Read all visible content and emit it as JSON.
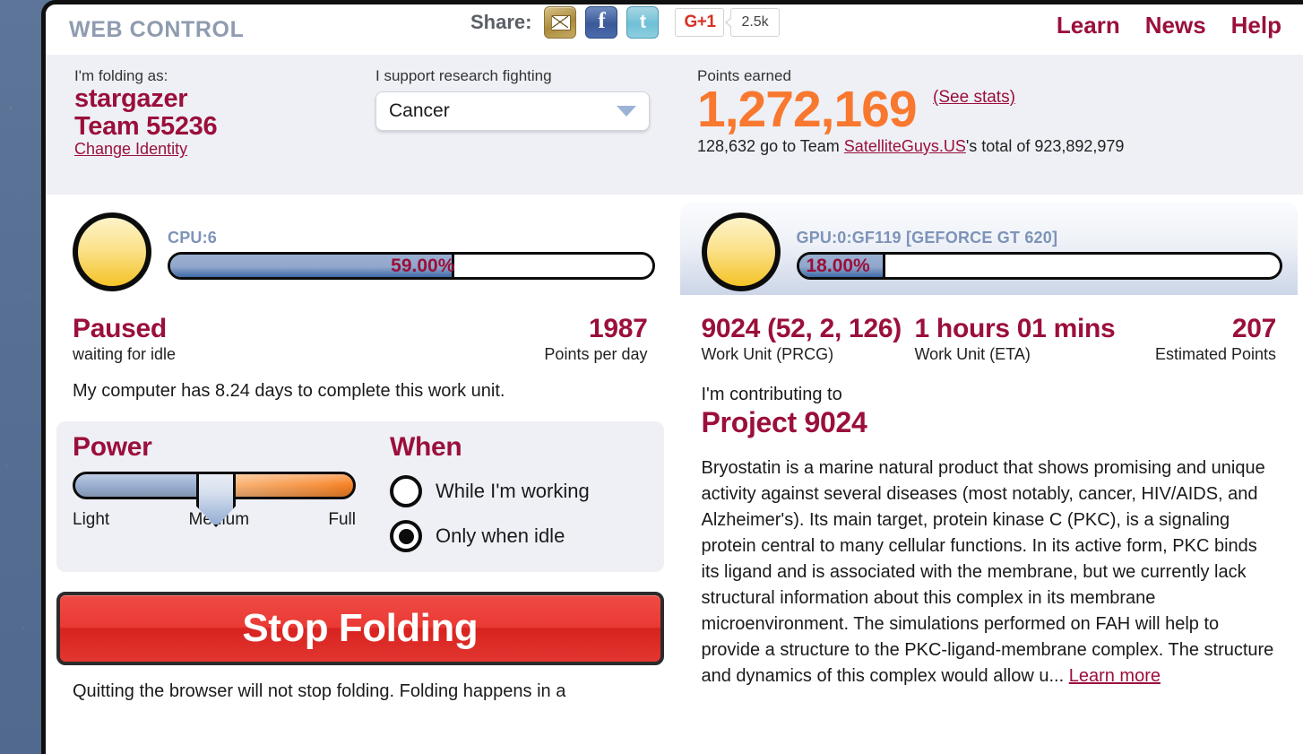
{
  "header": {
    "brand": "WEB CONTROL",
    "share_label": "Share:",
    "icons": [
      {
        "name": "email-share-icon",
        "glyph": "✉"
      },
      {
        "name": "facebook-share-icon",
        "glyph": "f"
      },
      {
        "name": "twitter-share-icon",
        "glyph": "t"
      }
    ],
    "gplus_label": "G+1",
    "gplus_count": "2.5k",
    "nav": [
      {
        "label": "Learn"
      },
      {
        "label": "News"
      },
      {
        "label": "Help"
      }
    ],
    "nav_color": "#9b0f3b",
    "brand_color": "#8f9bb0"
  },
  "identity": {
    "folding_as_label": "I'm folding as:",
    "user": "stargazer",
    "team": "Team 55236",
    "change_identity": "Change Identity",
    "support_label": "I support research fighting",
    "disease_selected": "Cancer",
    "points_label": "Points earned",
    "points_value": "1,272,169",
    "points_color": "#f9782f",
    "see_stats": "(See stats)",
    "team_contribution_pre": "128,632 go to Team ",
    "team_link": "SatelliteGuys.US",
    "team_contribution_post": "'s total of 923,892,979"
  },
  "cpu_slot": {
    "slot_name": "CPU:6",
    "progress_percent": 59,
    "progress_text": "59.00%",
    "status": "Paused",
    "status_sub": "waiting for idle",
    "ppd_value": "1987",
    "ppd_label": "Points per day",
    "eta_note": "My computer has 8.24 days to complete this work unit."
  },
  "gpu_slot": {
    "slot_name": "GPU:0:GF119 [GEFORCE GT 620]",
    "progress_percent": 18,
    "progress_text": "18.00%",
    "prcg_value": "9024 (52, 2, 126)",
    "prcg_label": "Work Unit (PRCG)",
    "eta_value": "1 hours 01 mins",
    "eta_label": "Work Unit (ETA)",
    "est_points_value": "207",
    "est_points_label": "Estimated Points",
    "contributing_label": "I'm contributing to",
    "project_title": "Project 9024",
    "description": "Bryostatin is a marine natural product that shows promising and unique activity against several diseases (most notably, cancer, HIV/AIDS, and Alzheimer's). Its main target, protein kinase C (PKC), is a signaling protein central to many cellular functions. In its active form, PKC binds its ligand and is associated with the membrane, but we currently lack structural information about this complex in its membrane microenvironment. The simulations performed on FAH will help to provide a structure to the PKC-ligand-membrane complex. The structure and dynamics of this complex would allow u...",
    "learn_more": "Learn more"
  },
  "controls": {
    "power_title": "Power",
    "power_ticks": [
      "Light",
      "Medium",
      "Full"
    ],
    "power_selected": "Medium",
    "when_title": "When",
    "when_options": [
      {
        "label": "While I'm working",
        "selected": false
      },
      {
        "label": "Only when idle",
        "selected": true
      }
    ],
    "stop_button": "Stop Folding",
    "quit_note": "Quitting the browser will not stop folding. Folding happens in a"
  }
}
